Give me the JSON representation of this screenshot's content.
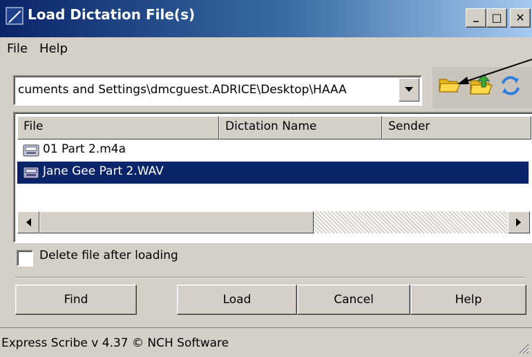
{
  "window": {
    "title": "Load Dictation File(s)",
    "minimize_label": "_",
    "maximize_label": "□",
    "close_label": "✕"
  },
  "menu": {
    "items": [
      "File",
      "Help"
    ]
  },
  "path_combo": {
    "value": "cuments and Settings\\dmcguest.ADRICE\\Desktop\\HAAA"
  },
  "toolbar": {
    "icons": [
      "open-folder-icon",
      "upload-icon",
      "refresh-icon"
    ]
  },
  "file_list": {
    "columns": [
      "File",
      "Dictation Name",
      "Sender"
    ],
    "rows": [
      {
        "name": "01 Part 2.m4a",
        "selected": false
      },
      {
        "name": "Jane Gee Part 2.WAV",
        "selected": true
      }
    ],
    "scroll_fraction": 0.54
  },
  "options": {
    "delete_after_loading_label": "Delete file after loading",
    "delete_after_loading_checked": false
  },
  "buttons": {
    "find": "Find",
    "load": "Load",
    "cancel": "Cancel",
    "help": "Help"
  },
  "status": {
    "text": "Express Scribe v 4.37 © NCH Software"
  },
  "colors": {
    "title_bar": "#0a246a",
    "selection": "#0a246a",
    "face": "#d4d0c8"
  }
}
